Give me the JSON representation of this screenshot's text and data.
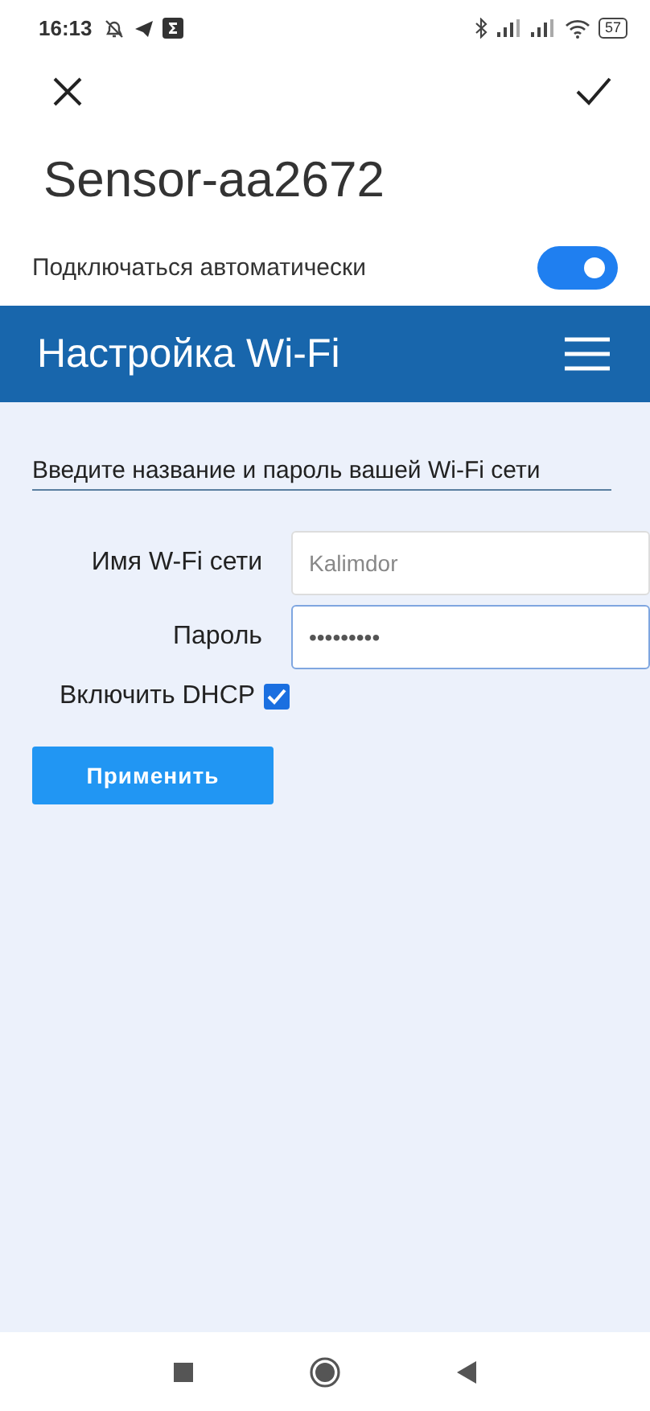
{
  "status_bar": {
    "time": "16:13",
    "battery": "57"
  },
  "dialog": {
    "title": "Sensor-aa2672"
  },
  "auto_connect": {
    "label": "Подключаться автоматически",
    "on": true
  },
  "page": {
    "title": "Настройка Wi-Fi",
    "heading": "Введите название и пароль вашей Wi-Fi сети",
    "fields": [
      {
        "label": "Имя W-Fi сети",
        "placeholder": "Kalimdor",
        "focused": false
      },
      {
        "label": "Пароль",
        "value": "•••••••••",
        "focused": true
      }
    ],
    "dhcp": {
      "label": "Включить DHCP",
      "checked": true
    },
    "apply_button": "Применить"
  }
}
